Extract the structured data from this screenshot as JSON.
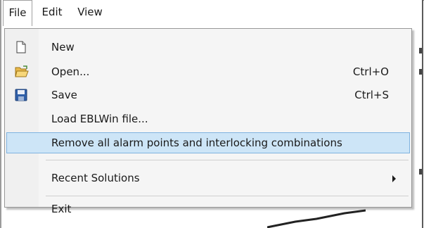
{
  "menubar": {
    "items": [
      {
        "label": "File",
        "active": true
      },
      {
        "label": "Edit",
        "active": false
      },
      {
        "label": "View",
        "active": false
      }
    ]
  },
  "file_menu": {
    "items": [
      {
        "label": "New",
        "shortcut": "",
        "icon": "new-document-icon"
      },
      {
        "label": "Open...",
        "shortcut": "Ctrl+O",
        "icon": "open-folder-icon"
      },
      {
        "label": "Save",
        "shortcut": "Ctrl+S",
        "icon": "save-floppy-icon"
      },
      {
        "label": "Load EBLWin file...",
        "shortcut": "",
        "icon": ""
      },
      {
        "label": "Remove all alarm points and interlocking combinations",
        "shortcut": "",
        "icon": "",
        "highlighted": true
      },
      {
        "label": "Recent Solutions",
        "shortcut": "",
        "icon": "",
        "submenu": true
      },
      {
        "label": "Exit",
        "shortcut": "",
        "icon": ""
      }
    ]
  },
  "colors": {
    "highlight_fill": "#cde5f7",
    "highlight_border": "#7fb3e0",
    "menu_background": "#f5f5f5"
  }
}
